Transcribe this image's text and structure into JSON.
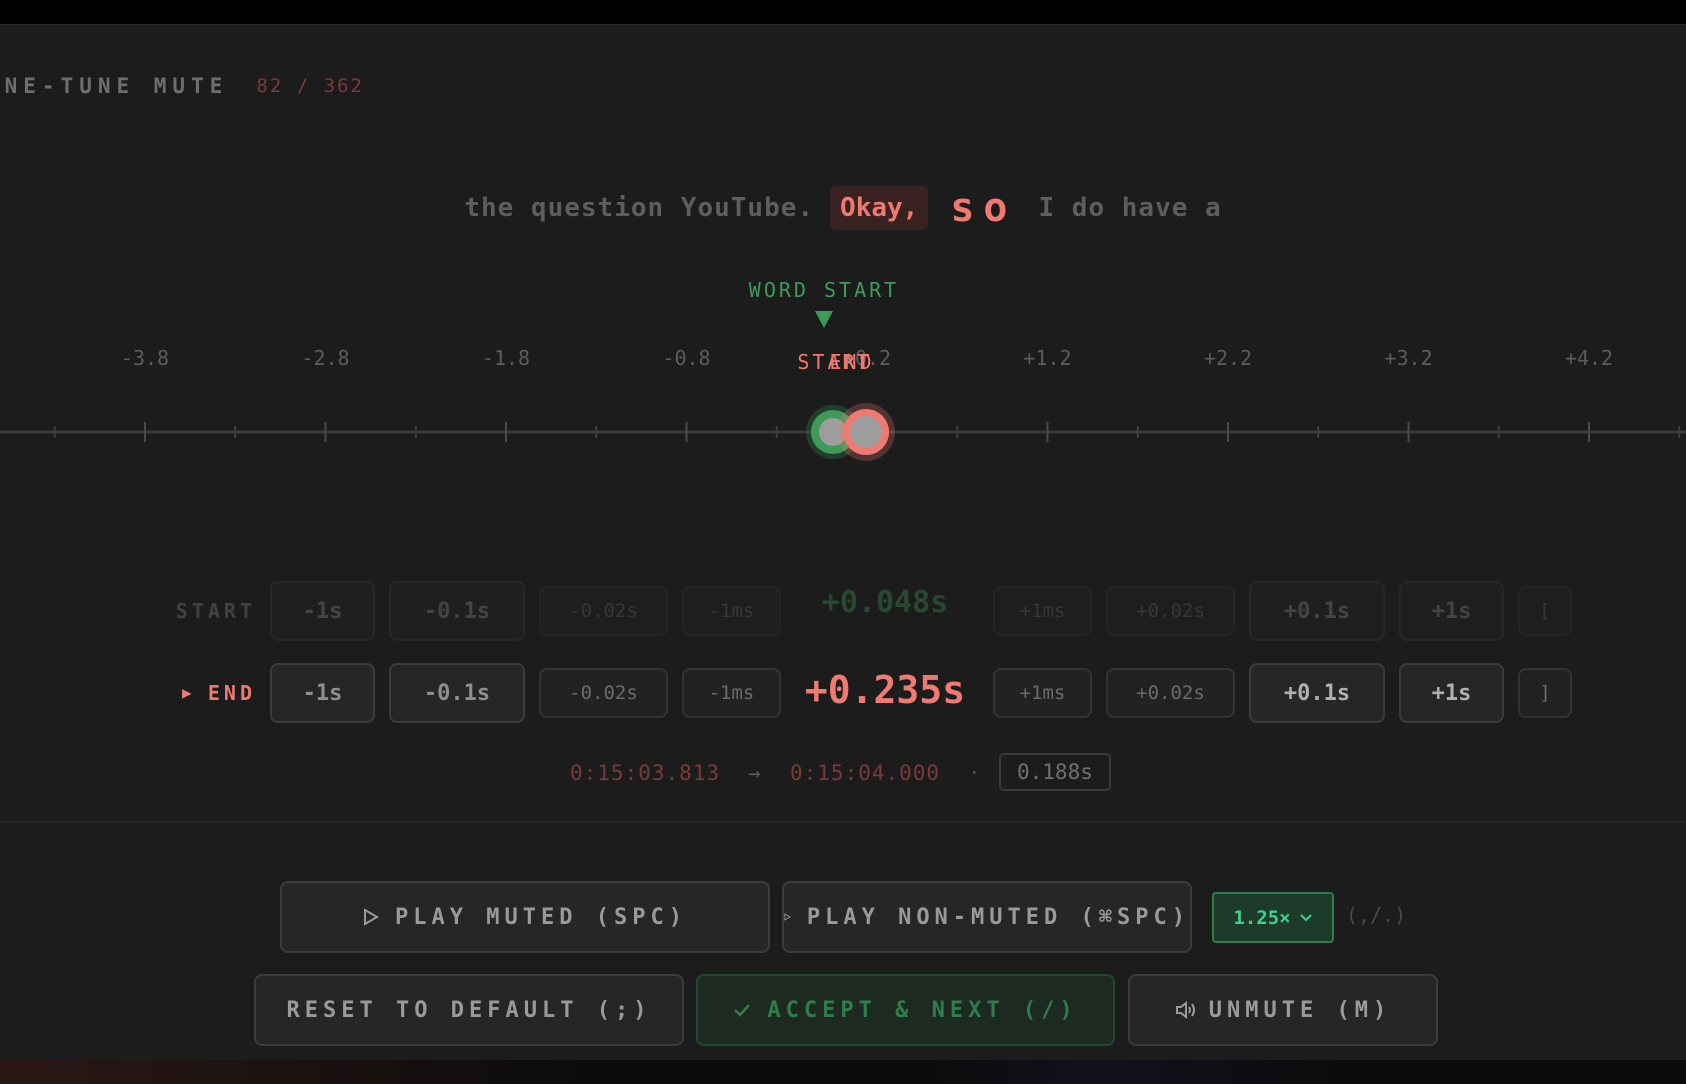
{
  "header": {
    "title": "INE-TUNE MUTE",
    "counter": "82 / 362"
  },
  "sentence": {
    "before": "the question YouTube.",
    "previous_word": "Okay,",
    "current_word": "so",
    "after": "I do have a"
  },
  "timeline": {
    "marker_label": "WORD START",
    "handle_labels": {
      "start": "START",
      "end": "END"
    },
    "ticks": [
      "-3.8",
      "-2.8",
      "-1.8",
      "-0.8",
      "+0.2",
      "+1.2",
      "+2.2",
      "+3.2",
      "+4.2"
    ],
    "start_handle_s": 0.048,
    "end_handle_s": 0.235
  },
  "start_row": {
    "label": "START",
    "buttons": [
      "-1s",
      "-0.1s",
      "-0.02s",
      "-1ms",
      "+1ms",
      "+0.02s",
      "+0.1s",
      "+1s",
      "["
    ],
    "value": "+0.048s"
  },
  "end_row": {
    "label": "END",
    "active_indicator": "▶",
    "buttons": [
      "-1s",
      "-0.1s",
      "-0.02s",
      "-1ms",
      "+1ms",
      "+0.02s",
      "+0.1s",
      "+1s",
      "]"
    ],
    "value": "+0.235s"
  },
  "range": {
    "from": "0:15:03.813",
    "arrow": "→",
    "to": "0:15:04.000",
    "sep": "·",
    "duration": "0.188s"
  },
  "actions": {
    "play_muted": "PLAY MUTED (SPC)",
    "play_non_muted": "PLAY NON-MUTED (⌘SPC)",
    "speed": "1.25×",
    "speed_hint": "(,/.)",
    "reset": "RESET TO DEFAULT (;)",
    "accept": "ACCEPT & NEXT (/)",
    "unmute": "UNMUTE (M)"
  },
  "icons": {
    "play": "play-triangle-icon",
    "check": "check-icon",
    "speaker": "speaker-icon",
    "chevron": "chevron-down-icon"
  },
  "colors": {
    "accent_red": "#f07a72",
    "accent_green": "#3fd08a",
    "word_start_green": "#3f9a5a",
    "background": "#1c1c1c"
  }
}
